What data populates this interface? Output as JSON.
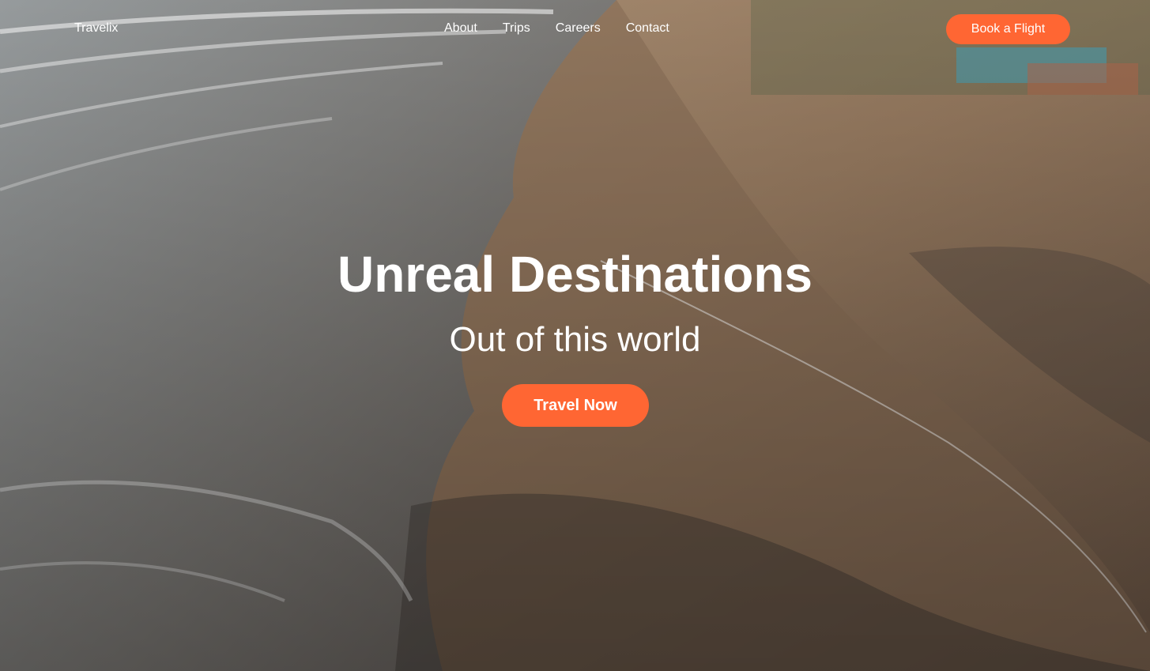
{
  "brand": {
    "name": "Travelix"
  },
  "nav": {
    "items": [
      {
        "label": "About"
      },
      {
        "label": "Trips"
      },
      {
        "label": "Careers"
      },
      {
        "label": "Contact"
      }
    ],
    "cta_label": "Book a Flight"
  },
  "hero": {
    "title": "Unreal Destinations",
    "subtitle": "Out of this world",
    "cta_label": "Travel Now",
    "background_icon": "aerial-beach-photo"
  },
  "colors": {
    "accent": "#ff6633",
    "text": "#ffffff",
    "sand": "#a88a6c",
    "water": "#7d8182"
  }
}
